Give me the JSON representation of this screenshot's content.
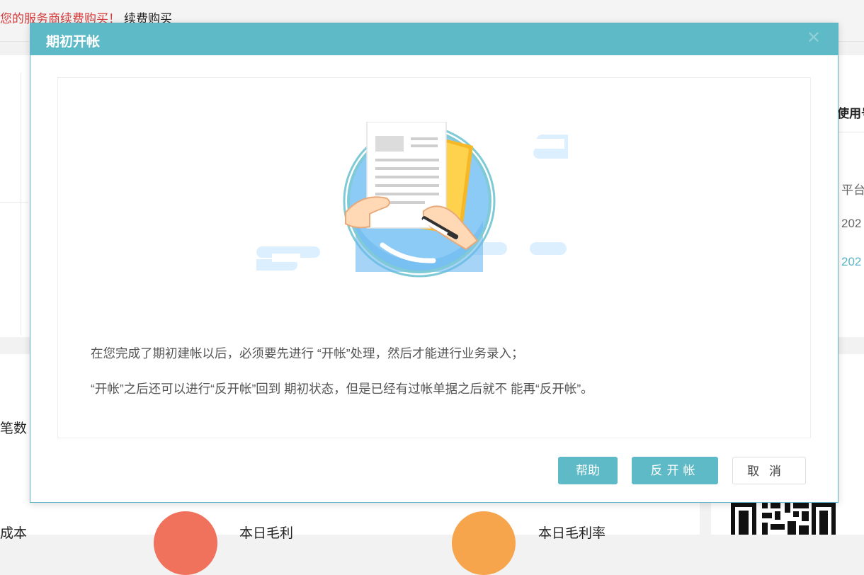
{
  "background": {
    "notice_text": "您的服务商续费购买！",
    "renew_link": "续费购买",
    "right_card": {
      "header": "使用号",
      "rows": [
        "平台",
        "202",
        "202"
      ]
    },
    "labels": {
      "count": "笔数",
      "cost": "成本",
      "profit_today": "本日毛利",
      "profit_rate_today": "本日毛利率"
    }
  },
  "dialog": {
    "title": "期初开帐",
    "close_icon": "close-icon",
    "illustration": "signing-document-illustration",
    "message_line1": "在您完成了期初建帐以后，必须要先进行 “开帐”处理，然后才能进行业务录入；",
    "message_line2": "“开帐”之后还可以进行“反开帐”回到 期初状态，但是已经有过帐单据之后就不 能再“反开帐”。",
    "buttons": {
      "help": "帮助",
      "unopen": "反开帐",
      "cancel": "取消"
    }
  },
  "colors": {
    "accent": "#5ebac6",
    "notice_red": "#d43b3b",
    "link_teal": "#5ab6c7"
  }
}
